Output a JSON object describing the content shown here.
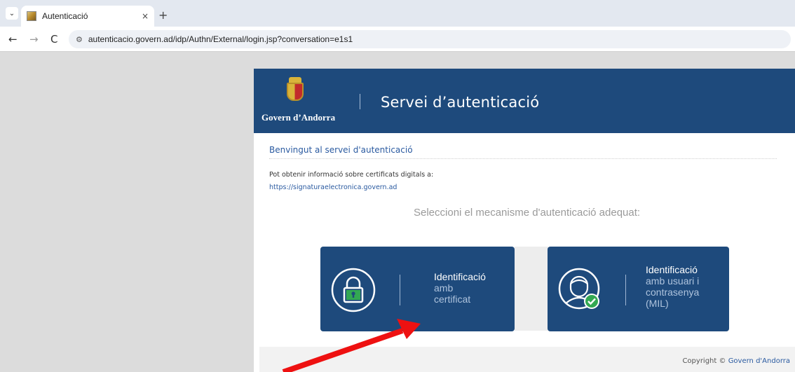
{
  "browser": {
    "tab_title": "Autenticació",
    "tab_close": "×",
    "new_tab": "+",
    "tab_menu": "⌄",
    "url": "autenticacio.govern.ad/idp/Authn/External/login.jsp?conversation=e1s1",
    "nav": {
      "back": "←",
      "forward": "→",
      "reload": "C"
    },
    "site_icon": "tune-icon"
  },
  "header": {
    "org": "Govern d’Andorra",
    "title": "Servei d’autenticació"
  },
  "main": {
    "welcome": "Benvingut al servei d'autenticació",
    "info_text": "Pot obtenir informació sobre certificats digitals a:",
    "info_link": "https://signaturaelectronica.govern.ad",
    "prompt": "Seleccioni el mecanisme d'autenticació adequat:"
  },
  "options": {
    "certificate": {
      "title": "Identificació",
      "line1": "amb",
      "line2": "certificat",
      "icon": "padlock-icon"
    },
    "user_password": {
      "title": "Identificació",
      "line1": "amb usuari i",
      "line2": "contrasenya",
      "line3": "(MIL)",
      "icon": "user-check-icon"
    }
  },
  "footer": {
    "copyright_prefix": "Copyright © ",
    "copyright_link": "Govern d'Andorra"
  },
  "colors": {
    "brand_blue": "#1e4a7c",
    "link_blue": "#2a5aa0",
    "annotation_red": "#ee1111",
    "check_green": "#33a852"
  }
}
